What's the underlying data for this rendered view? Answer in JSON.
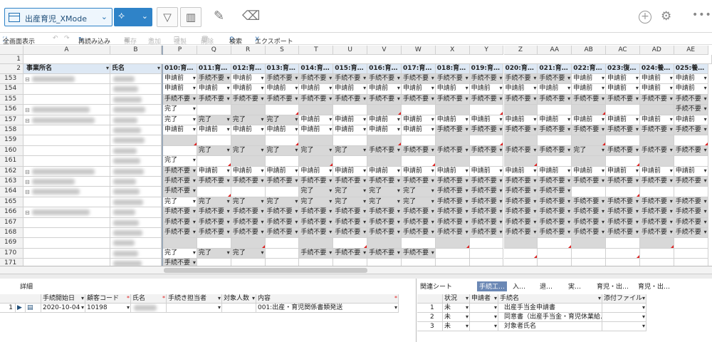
{
  "toolbar": {
    "mode_label": "出産育児_XMode",
    "colors": {
      "accent": "#2f83c8",
      "header_band": "#dde8f4",
      "gray_cell": "#d8d8d8",
      "required": "#e02020"
    }
  },
  "actions": {
    "fullscreen": "全画面表示",
    "undo": "↶",
    "redo": "↷",
    "reload": "再読み込み",
    "save": "保存",
    "add": "追加",
    "copy": "複製",
    "delete": "削除",
    "search": "検索",
    "export": "エクスポート"
  },
  "sheet": {
    "fixed_columns": [
      "A",
      "B"
    ],
    "columns": [
      "P",
      "Q",
      "R",
      "S",
      "T",
      "U",
      "V",
      "W",
      "X",
      "Y",
      "Z",
      "AA",
      "AB",
      "AC",
      "AD",
      "AE"
    ],
    "row1_number": "1",
    "row2_number": "2",
    "header_a": "事業所名",
    "header_b": "氏名",
    "headers": [
      "010:育…",
      "011:育…",
      "012:育…",
      "013:育…",
      "014:育…",
      "015:育…",
      "016:育…",
      "017:育…",
      "018:育…",
      "019:育…",
      "020:育…",
      "021:育…",
      "022:育…",
      "023:復…",
      "024:養…",
      "025:養…"
    ],
    "rows": [
      {
        "num": "153",
        "cells": [
          "申請前",
          "手続不要",
          "申請前",
          "手続不要",
          "手続不要",
          "手続不要",
          "手続不要",
          "手続不要",
          "手続不要",
          "手続不要",
          "手続不要",
          "手続不要",
          "申請前",
          "申請前",
          "申請前",
          "申請前"
        ]
      },
      {
        "num": "154",
        "cells": [
          "申請前",
          "申請前",
          "申請前",
          "申請前",
          "申請前",
          "申請前",
          "申請前",
          "申請前",
          "申請前",
          "申請前",
          "申請前",
          "申請前",
          "申請前",
          "申請前",
          "申請前",
          "申請前"
        ]
      },
      {
        "num": "155",
        "cells": [
          "手続不要",
          "手続不要",
          "手続不要",
          "手続不要",
          "手続不要",
          "手続不要",
          "手続不要",
          "手続不要",
          "手続不要",
          "手続不要",
          "手続不要",
          "手続不要",
          "手続不要",
          "手続不要",
          "手続不要",
          "手続不要"
        ]
      },
      {
        "num": "156",
        "cells": [
          "完了",
          "",
          "",
          "",
          "",
          "",
          "",
          "",
          "",
          "",
          "",
          "",
          "",
          "",
          "",
          "手続不要"
        ]
      },
      {
        "num": "157",
        "cells": [
          "完了",
          "完了",
          "完了",
          "完了",
          "申請前",
          "申請前",
          "申請前",
          "申請前",
          "申請前",
          "申請前",
          "申請前",
          "申請前",
          "申請前",
          "申請前",
          "申請前",
          "申請前"
        ]
      },
      {
        "num": "158",
        "cells": [
          "申請前",
          "申請前",
          "申請前",
          "申請前",
          "申請前",
          "申請前",
          "申請前",
          "申請前",
          "手続不要",
          "手続不要",
          "手続不要",
          "手続不要",
          "手続不要",
          "手続不要",
          "手続不要",
          "手続不要"
        ]
      },
      {
        "num": "159",
        "cells": [
          "",
          "",
          "",
          "",
          "",
          "",
          "",
          "",
          "",
          "",
          "",
          "",
          "",
          "",
          "",
          ""
        ]
      },
      {
        "num": "160",
        "cells": [
          "",
          "完了",
          "完了",
          "完了",
          "完了",
          "完了",
          "手続不要",
          "手続不要",
          "手続不要",
          "手続不要",
          "手続不要",
          "手続不要",
          "完了",
          "手続不要",
          "手続不要",
          "手続不要"
        ]
      },
      {
        "num": "161",
        "cells": [
          "完了",
          "",
          "",
          "",
          "",
          "",
          "",
          "",
          "",
          "",
          "",
          "",
          "",
          "",
          "",
          ""
        ]
      },
      {
        "num": "162",
        "cells": [
          "手続不要",
          "申請前",
          "申請前",
          "申請前",
          "申請前",
          "申請前",
          "申請前",
          "申請前",
          "申請前",
          "申請前",
          "申請前",
          "申請前",
          "申請前",
          "申請前",
          "申請前",
          "申請前"
        ]
      },
      {
        "num": "163",
        "cells": [
          "手続不要",
          "手続不要",
          "手続不要",
          "手続不要",
          "手続不要",
          "手続不要",
          "手続不要",
          "手続不要",
          "手続不要",
          "手続不要",
          "手続不要",
          "手続不要",
          "手続不要",
          "手続不要",
          "手続不要",
          "手続不要"
        ]
      },
      {
        "num": "164",
        "cells": [
          "手続不要",
          "",
          "",
          "",
          "完了",
          "完了",
          "完了",
          "完了",
          "手続不要",
          "手続不要",
          "手続不要",
          "手続不要",
          "",
          "",
          "",
          ""
        ]
      },
      {
        "num": "165",
        "cells": [
          "完了",
          "完了",
          "完了",
          "完了",
          "完了",
          "完了",
          "完了",
          "完了",
          "手続不要",
          "手続不要",
          "手続不要",
          "手続不要",
          "手続不要",
          "手続不要",
          "手続不要",
          "手続不要"
        ]
      },
      {
        "num": "166",
        "cells": [
          "手続不要",
          "手続不要",
          "手続不要",
          "手続不要",
          "手続不要",
          "手続不要",
          "手続不要",
          "手続不要",
          "手続不要",
          "手続不要",
          "手続不要",
          "手続不要",
          "手続不要",
          "手続不要",
          "手続不要",
          "手続不要"
        ]
      },
      {
        "num": "167",
        "cells": [
          "手続不要",
          "手続不要",
          "手続不要",
          "手続不要",
          "手続不要",
          "手続不要",
          "手続不要",
          "手続不要",
          "手続不要",
          "手続不要",
          "手続不要",
          "手続不要",
          "手続不要",
          "手続不要",
          "手続不要",
          "手続不要"
        ]
      },
      {
        "num": "168",
        "cells": [
          "手続不要",
          "手続不要",
          "手続不要",
          "手続不要",
          "手続不要",
          "手続不要",
          "手続不要",
          "手続不要",
          "手続不要",
          "手続不要",
          "手続不要",
          "手続不要",
          "手続不要",
          "手続不要",
          "手続不要",
          "手続不要"
        ]
      },
      {
        "num": "169",
        "cells": [
          "",
          "",
          "",
          "",
          "",
          "",
          "",
          "",
          "",
          "",
          "",
          "",
          "",
          "",
          "",
          ""
        ]
      },
      {
        "num": "170",
        "cells": [
          "完了",
          "完了",
          "完了",
          "",
          "手続不要",
          "手続不要",
          "手続不要",
          "手続不要",
          "",
          "",
          "",
          "",
          "",
          "",
          "",
          ""
        ]
      },
      {
        "num": "171",
        "cells": [
          "手続不要",
          "",
          "",
          "",
          "",
          "",
          "",
          "",
          "",
          "",
          "",
          "",
          "",
          "",
          "",
          ""
        ]
      }
    ]
  },
  "detail": {
    "title": "詳細",
    "columns": [
      {
        "label": "手続開始日",
        "required": false
      },
      {
        "label": "顧客コード",
        "required": true
      },
      {
        "label": "氏名",
        "required": true
      },
      {
        "label": "手続き担当者",
        "required": false
      },
      {
        "label": "対象人数",
        "required": false
      },
      {
        "label": "内容",
        "required": true
      }
    ],
    "row_num": "1",
    "date": "2020-10-04",
    "code": "10198",
    "content": "001:出産・育児関係書類発送"
  },
  "related": {
    "tabs": [
      "関連シート",
      "手続工…",
      "入…",
      "退…",
      "実…",
      "育児・出…",
      "育児・出…"
    ],
    "columns": [
      "状況",
      "申請者",
      "手続名",
      "添付ファイル"
    ],
    "rows": [
      {
        "num": "1",
        "status": "未",
        "name": "出産手当金申請書"
      },
      {
        "num": "2",
        "status": "未",
        "name": "同意書（出産手当金・育児休業給…"
      },
      {
        "num": "3",
        "status": "未",
        "name": "対象者氏名"
      }
    ]
  }
}
